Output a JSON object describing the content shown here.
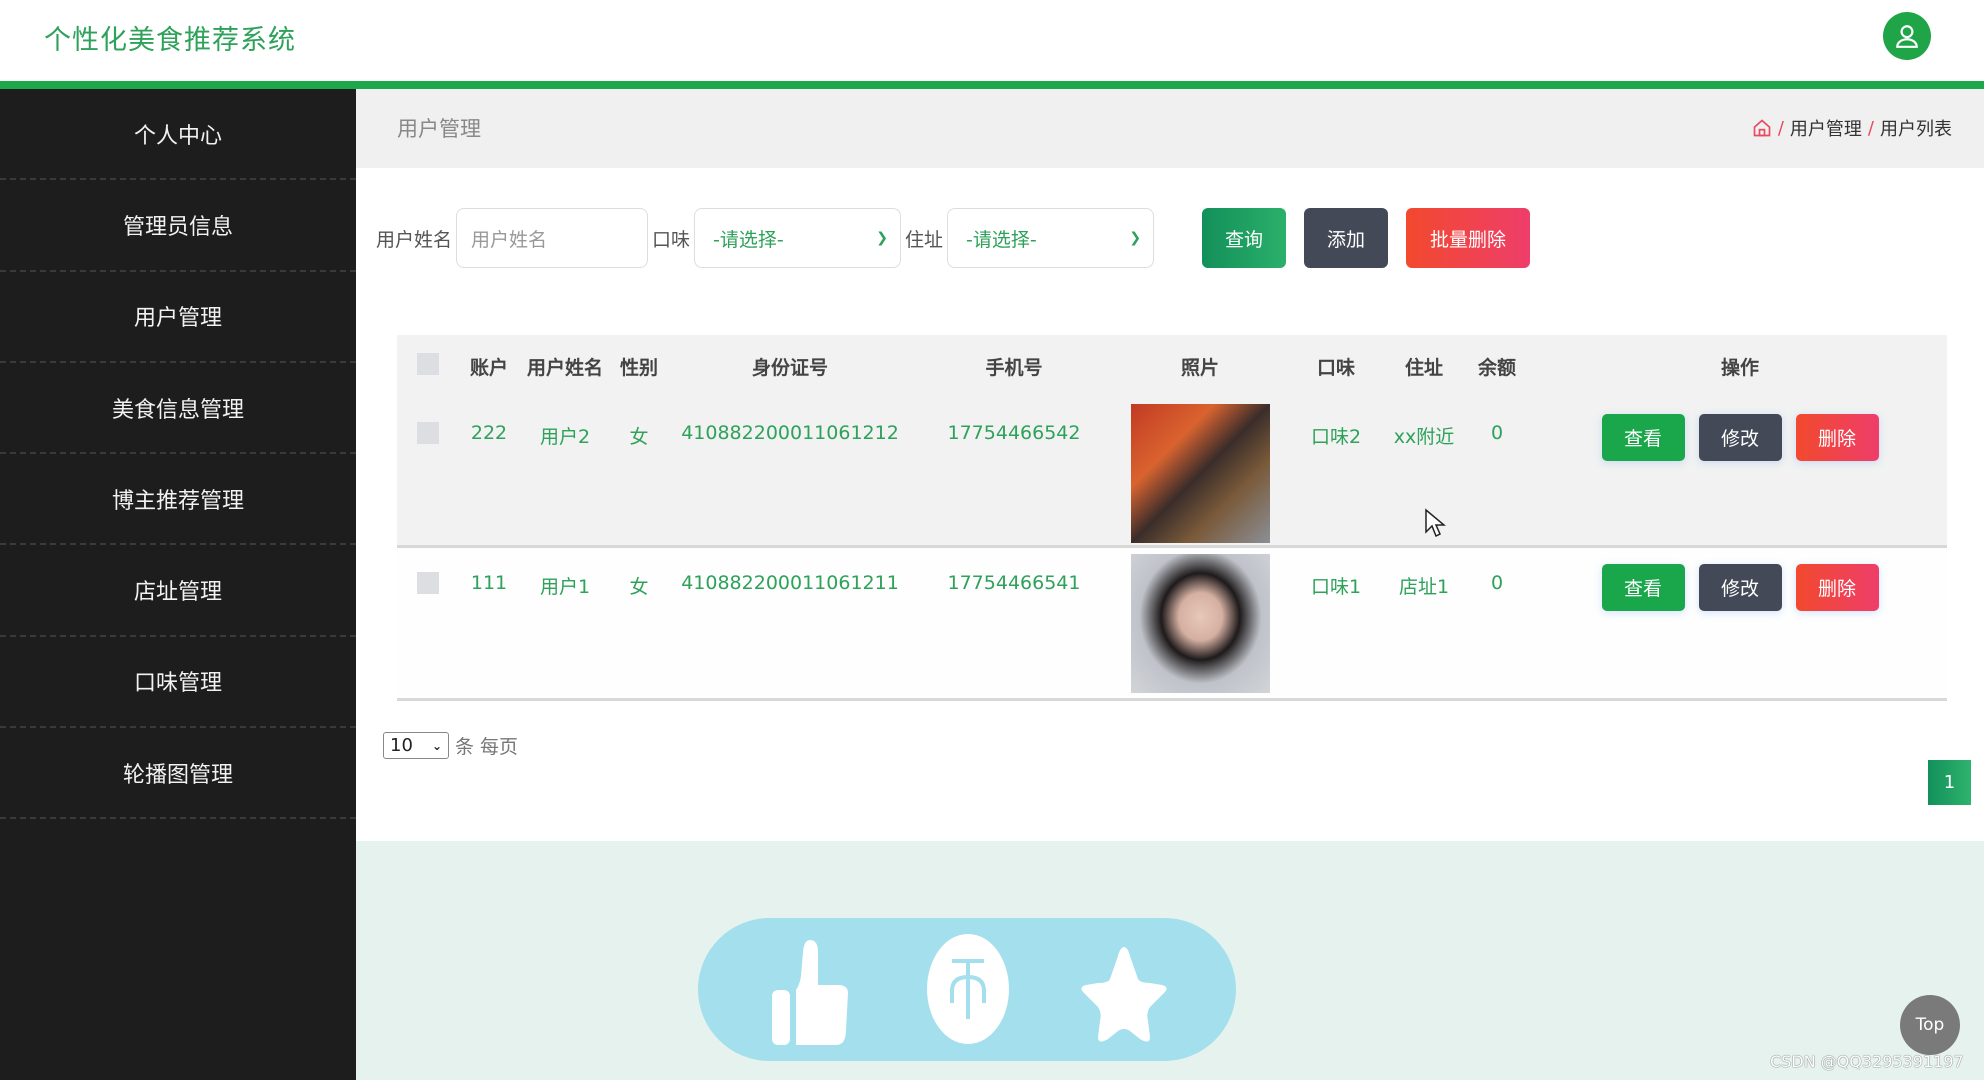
{
  "header": {
    "app_title": "个性化美食推荐系统",
    "avatar_icon": "user-icon",
    "accent_color": "#1da84a"
  },
  "sidebar": {
    "items": [
      {
        "label": "个人中心"
      },
      {
        "label": "管理员信息"
      },
      {
        "label": "用户管理"
      },
      {
        "label": "美食信息管理"
      },
      {
        "label": "博主推荐管理"
      },
      {
        "label": "店址管理"
      },
      {
        "label": "口味管理"
      },
      {
        "label": "轮播图管理"
      }
    ]
  },
  "page": {
    "title": "用户管理",
    "breadcrumb": {
      "home_icon": "home-icon",
      "separator": "/",
      "items": [
        "用户管理",
        "用户列表"
      ]
    }
  },
  "search": {
    "name_label": "用户姓名",
    "name_placeholder": "用户姓名",
    "taste_label": "口味",
    "taste_value": "-请选择-",
    "address_label": "住址",
    "address_value": "-请选择-",
    "query_button": "查询",
    "add_button": "添加",
    "bulk_delete_button": "批量删除"
  },
  "table": {
    "columns": [
      "账户",
      "用户姓名",
      "性别",
      "身份证号",
      "手机号",
      "照片",
      "口味",
      "住址",
      "余额",
      "操作"
    ],
    "rows": [
      {
        "account": "222",
        "name": "用户2",
        "gender": "女",
        "id_number": "410882200011061212",
        "phone": "17754466542",
        "photo": "photo",
        "taste": "口味2",
        "address": "xx附近",
        "balance": "0"
      },
      {
        "account": "111",
        "name": "用户1",
        "gender": "女",
        "id_number": "410882200011061211",
        "phone": "17754466541",
        "photo": "photo",
        "taste": "口味1",
        "address": "店址1",
        "balance": "0"
      }
    ],
    "actions": {
      "view": "查看",
      "edit": "修改",
      "delete": "删除"
    }
  },
  "pagination": {
    "page_size": "10",
    "page_size_label": "条 每页",
    "current_page": "1"
  },
  "floating": {
    "icons": [
      "thumbs-up-icon",
      "coin-icon",
      "star-icon"
    ],
    "top_button": "Top",
    "watermark": "CSDN @QQ3295391197"
  }
}
